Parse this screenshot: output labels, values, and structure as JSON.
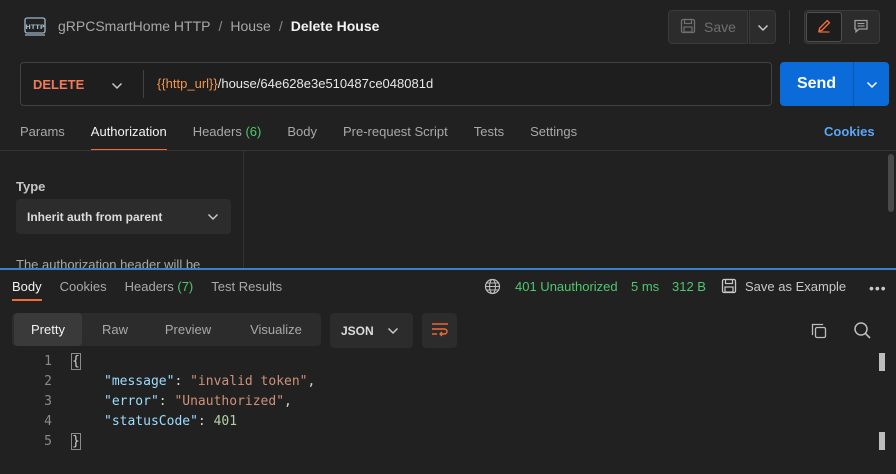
{
  "breadcrumb": {
    "collection": "gRPCSmartHome HTTP",
    "folder": "House",
    "request": "Delete House",
    "separator": "/"
  },
  "toolbar": {
    "save_label": "Save"
  },
  "request": {
    "method": "DELETE",
    "url_variable": "{{http_url}}",
    "url_path": "/house/64e628e3e510487ce048081d",
    "send_label": "Send"
  },
  "request_tabs": [
    {
      "label": "Params",
      "count": ""
    },
    {
      "label": "Authorization",
      "count": ""
    },
    {
      "label": "Headers",
      "count": "(6)"
    },
    {
      "label": "Body",
      "count": ""
    },
    {
      "label": "Pre-request Script",
      "count": ""
    },
    {
      "label": "Tests",
      "count": ""
    },
    {
      "label": "Settings",
      "count": ""
    }
  ],
  "cookies_link": "Cookies",
  "auth": {
    "type_label": "Type",
    "type_value": "Inherit auth from parent",
    "note": "The authorization header will be"
  },
  "response": {
    "tabs": [
      {
        "label": "Body",
        "count": ""
      },
      {
        "label": "Cookies",
        "count": ""
      },
      {
        "label": "Headers",
        "count": "(7)"
      },
      {
        "label": "Test Results",
        "count": ""
      }
    ],
    "status": "401 Unauthorized",
    "time": "5 ms",
    "size": "312 B",
    "save_example": "Save as Example",
    "more": "•••",
    "format_tabs": [
      "Pretty",
      "Raw",
      "Preview",
      "Visualize"
    ],
    "format_select": "JSON",
    "code": {
      "line_numbers": [
        "1",
        "2",
        "3",
        "4",
        "5"
      ],
      "open_brace": "{",
      "close_brace": "}",
      "lines": [
        {
          "key": "\"message\"",
          "value": "\"invalid token\"",
          "suffix": ","
        },
        {
          "key": "\"error\"",
          "value": "\"Unauthorized\"",
          "suffix": ","
        },
        {
          "key": "\"statusCode\"",
          "value": "401",
          "suffix": ""
        }
      ]
    }
  },
  "colors": {
    "accent_orange": "#f26b3a",
    "method_red": "#f17a5c",
    "variable_orange": "#f1964c",
    "send_blue": "#0b6bd9",
    "status_green": "#4ec76d",
    "link_blue": "#5aa7f5"
  }
}
